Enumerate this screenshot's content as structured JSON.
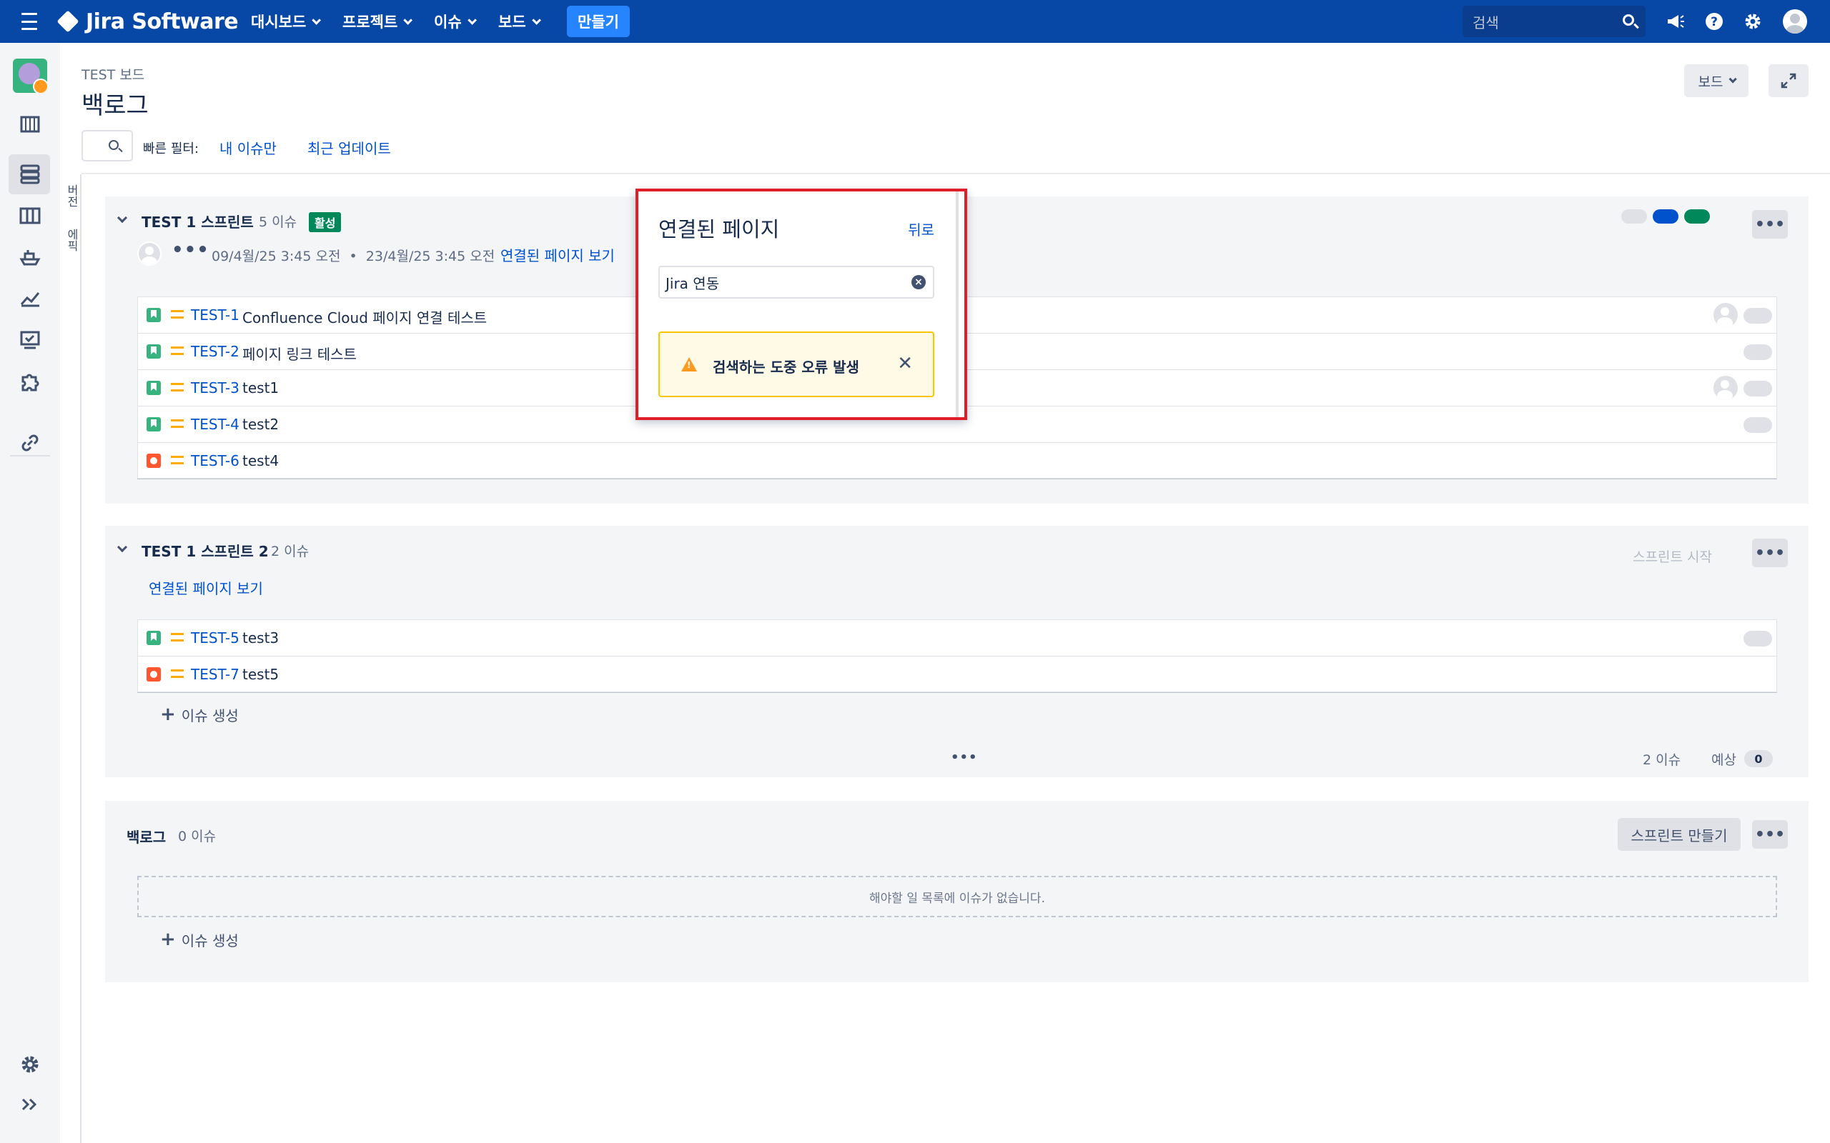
{
  "topbar": {
    "logo": "Jira Software",
    "nav": [
      "대시보드",
      "프로젝트",
      "이슈",
      "보드"
    ],
    "create": "만들기",
    "search_placeholder": "검색"
  },
  "header": {
    "breadcrumb": "TEST 보드",
    "title": "백로그",
    "board_button": "보드"
  },
  "quick_filters": {
    "label": "빠른 필터:",
    "items": [
      "내 이슈만",
      "최근 업데이트"
    ]
  },
  "side_tabs": [
    "버전",
    "에픽"
  ],
  "sprint1": {
    "title": "TEST 1 스프린트",
    "count": "5 이슈",
    "status": "활성",
    "dates": "09/4월/25 3:45 오전  •  23/4월/25 3:45 오전",
    "linked_pages": "연결된 페이지 보기",
    "status_colors": [
      "#dfe1e6",
      "#0052cc",
      "#00875a"
    ],
    "issues": [
      {
        "type": "story",
        "key": "TEST-1",
        "summary": "Confluence Cloud 페이지 연결 테스트",
        "assignee": true
      },
      {
        "type": "story",
        "key": "TEST-2",
        "summary": "페이지 링크 테스트",
        "assignee": false
      },
      {
        "type": "story",
        "key": "TEST-3",
        "summary": "test1",
        "assignee": true
      },
      {
        "type": "story",
        "key": "TEST-4",
        "summary": "test2",
        "assignee": false
      },
      {
        "type": "bug",
        "key": "TEST-6",
        "summary": "test4",
        "assignee": false
      }
    ]
  },
  "sprint2": {
    "title": "TEST 1 스프린트 2",
    "count": "2 이슈",
    "start_sprint": "스프린트 시작",
    "linked_pages": "연결된 페이지 보기",
    "issues": [
      {
        "type": "story",
        "key": "TEST-5",
        "summary": "test3"
      },
      {
        "type": "bug",
        "key": "TEST-7",
        "summary": "test5"
      }
    ],
    "create_issue": "이슈 생성",
    "footer_count": "2 이슈",
    "footer_estimate_label": "예상",
    "footer_estimate_value": "0"
  },
  "backlog": {
    "title": "백로그",
    "count": "0 이슈",
    "create_sprint": "스프린트 만들기",
    "empty_message": "해야할 일 목록에 이슈가 없습니다.",
    "create_issue": "이슈 생성"
  },
  "popup": {
    "title": "연결된 페이지",
    "back": "뒤로",
    "search_value": "Jira 연동",
    "error": "검색하는 도중 오류 발생"
  }
}
